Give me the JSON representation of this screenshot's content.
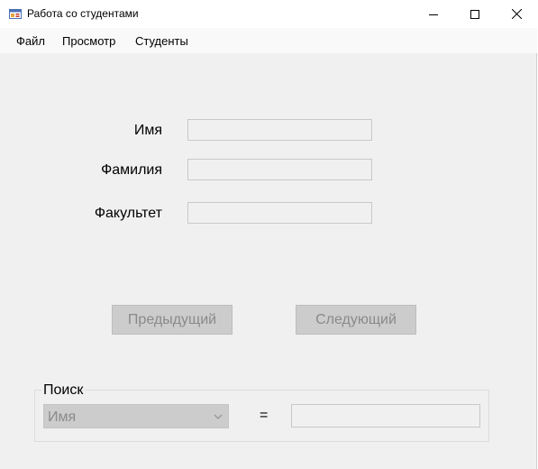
{
  "window": {
    "title": "Работа со студентами",
    "icon": "form-icon",
    "controls": [
      "minimize-icon",
      "maximize-icon",
      "close-icon"
    ]
  },
  "menu": {
    "items": [
      "Файл",
      "Просмотр",
      "Студенты"
    ]
  },
  "form": {
    "first_name_label": "Имя",
    "last_name_label": "Фамилия",
    "faculty_label": "Факультет",
    "first_name_value": "",
    "last_name_value": "",
    "faculty_value": ""
  },
  "navigation": {
    "prev_label": "Предыдущий",
    "next_label": "Следующий"
  },
  "search": {
    "title": "Поиск",
    "field_selected": "Имя",
    "operator": "=",
    "value": ""
  },
  "colors": {
    "window_bg": "#f0f0f0",
    "disabled_bg": "#cccccc",
    "disabled_text": "#8a8a8a"
  }
}
